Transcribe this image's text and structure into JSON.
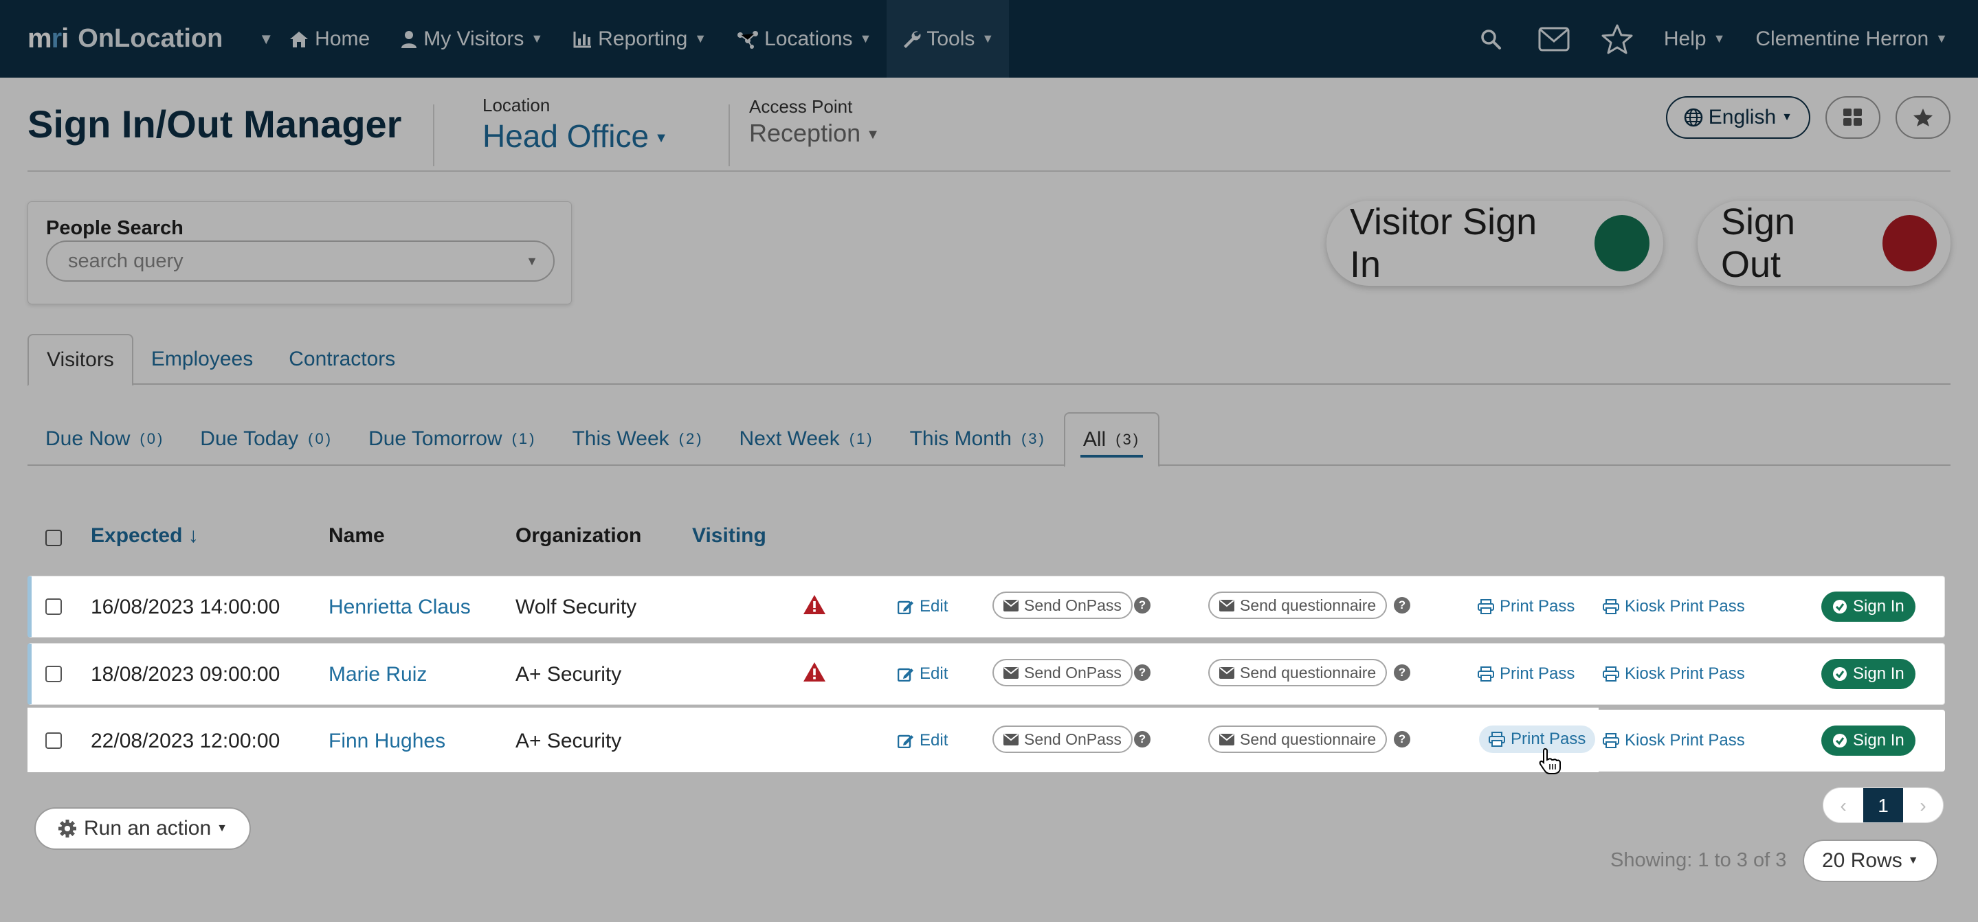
{
  "brand": {
    "mark_left": "m",
    "mark_accent": "r",
    "mark_right": "i",
    "name": "OnLocation"
  },
  "nav": {
    "items": [
      {
        "label": "Home",
        "icon": "home-icon"
      },
      {
        "label": "My Visitors",
        "icon": "user-icon"
      },
      {
        "label": "Reporting",
        "icon": "bar-chart-icon"
      },
      {
        "label": "Locations",
        "icon": "network-icon"
      },
      {
        "label": "Tools",
        "icon": "wrench-icon"
      }
    ],
    "help": "Help",
    "user": "Clementine Herron"
  },
  "header": {
    "title": "Sign In/Out Manager",
    "location_label": "Location",
    "location_value": "Head Office",
    "access_label": "Access Point",
    "access_value": "Reception",
    "language": "English"
  },
  "search": {
    "label": "People Search",
    "placeholder": "search query"
  },
  "actions": {
    "sign_in": "Visitor Sign In",
    "sign_out": "Sign Out"
  },
  "tabs": [
    "Visitors",
    "Employees",
    "Contractors"
  ],
  "subtabs": [
    {
      "label": "Due Now",
      "count": "(0)"
    },
    {
      "label": "Due Today",
      "count": "(0)"
    },
    {
      "label": "Due Tomorrow",
      "count": "(1)"
    },
    {
      "label": "This Week",
      "count": "(2)"
    },
    {
      "label": "Next Week",
      "count": "(1)"
    },
    {
      "label": "This Month",
      "count": "(3)"
    },
    {
      "label": "All",
      "count": "(3)"
    }
  ],
  "table": {
    "headers": {
      "expected": "Expected",
      "sort_arrow": "↓",
      "name": "Name",
      "organization": "Organization",
      "visiting": "Visiting"
    },
    "action_labels": {
      "edit": "Edit",
      "send_onpass": "Send OnPass",
      "send_questionnaire": "Send questionnaire",
      "print_pass": "Print Pass",
      "kiosk_print_pass": "Kiosk Print Pass",
      "sign_in": "Sign In",
      "help": "?"
    },
    "rows": [
      {
        "expected": "16/08/2023 14:00:00",
        "name": "Henrietta Claus",
        "organization": "Wolf Security",
        "warning": true
      },
      {
        "expected": "18/08/2023 09:00:00",
        "name": "Marie Ruiz",
        "organization": "A+ Security",
        "warning": true
      },
      {
        "expected": "22/08/2023 12:00:00",
        "name": "Finn Hughes",
        "organization": "A+ Security",
        "warning": false
      }
    ]
  },
  "footer": {
    "run_action": "Run an action",
    "page": "1",
    "prev": "‹",
    "next": "›",
    "showing": "Showing: 1 to 3 of 3",
    "rows_per_page": "20 Rows"
  },
  "colors": {
    "nav_bg": "#0d3047",
    "link": "#1f6e9e",
    "sign_in_dot": "#137453",
    "sign_out_dot": "#b01c24",
    "warning": "#b01c24",
    "sign_in_button": "#137453"
  }
}
